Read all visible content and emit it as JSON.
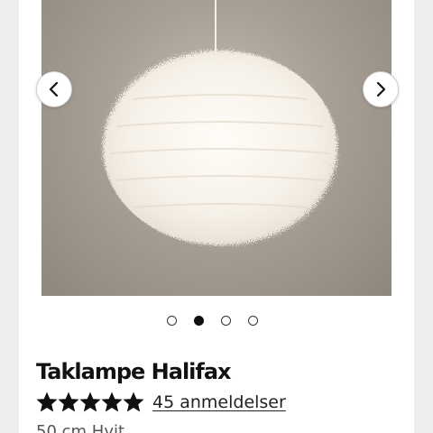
{
  "product": {
    "title": "Taklampe Halifax",
    "rating": 5,
    "rating_max": 5,
    "reviews_link": "45 anmeldelser",
    "variant": "50 cm Hvit"
  },
  "gallery": {
    "image_alt": "Taklampe Halifax",
    "slide_count": 4,
    "active_slide": 2,
    "prev_icon": "chevron-left-icon",
    "next_icon": "chevron-right-icon"
  },
  "colors": {
    "background": "#ededed",
    "card": "#ffffff",
    "text": "#111111",
    "star": "#111111"
  }
}
